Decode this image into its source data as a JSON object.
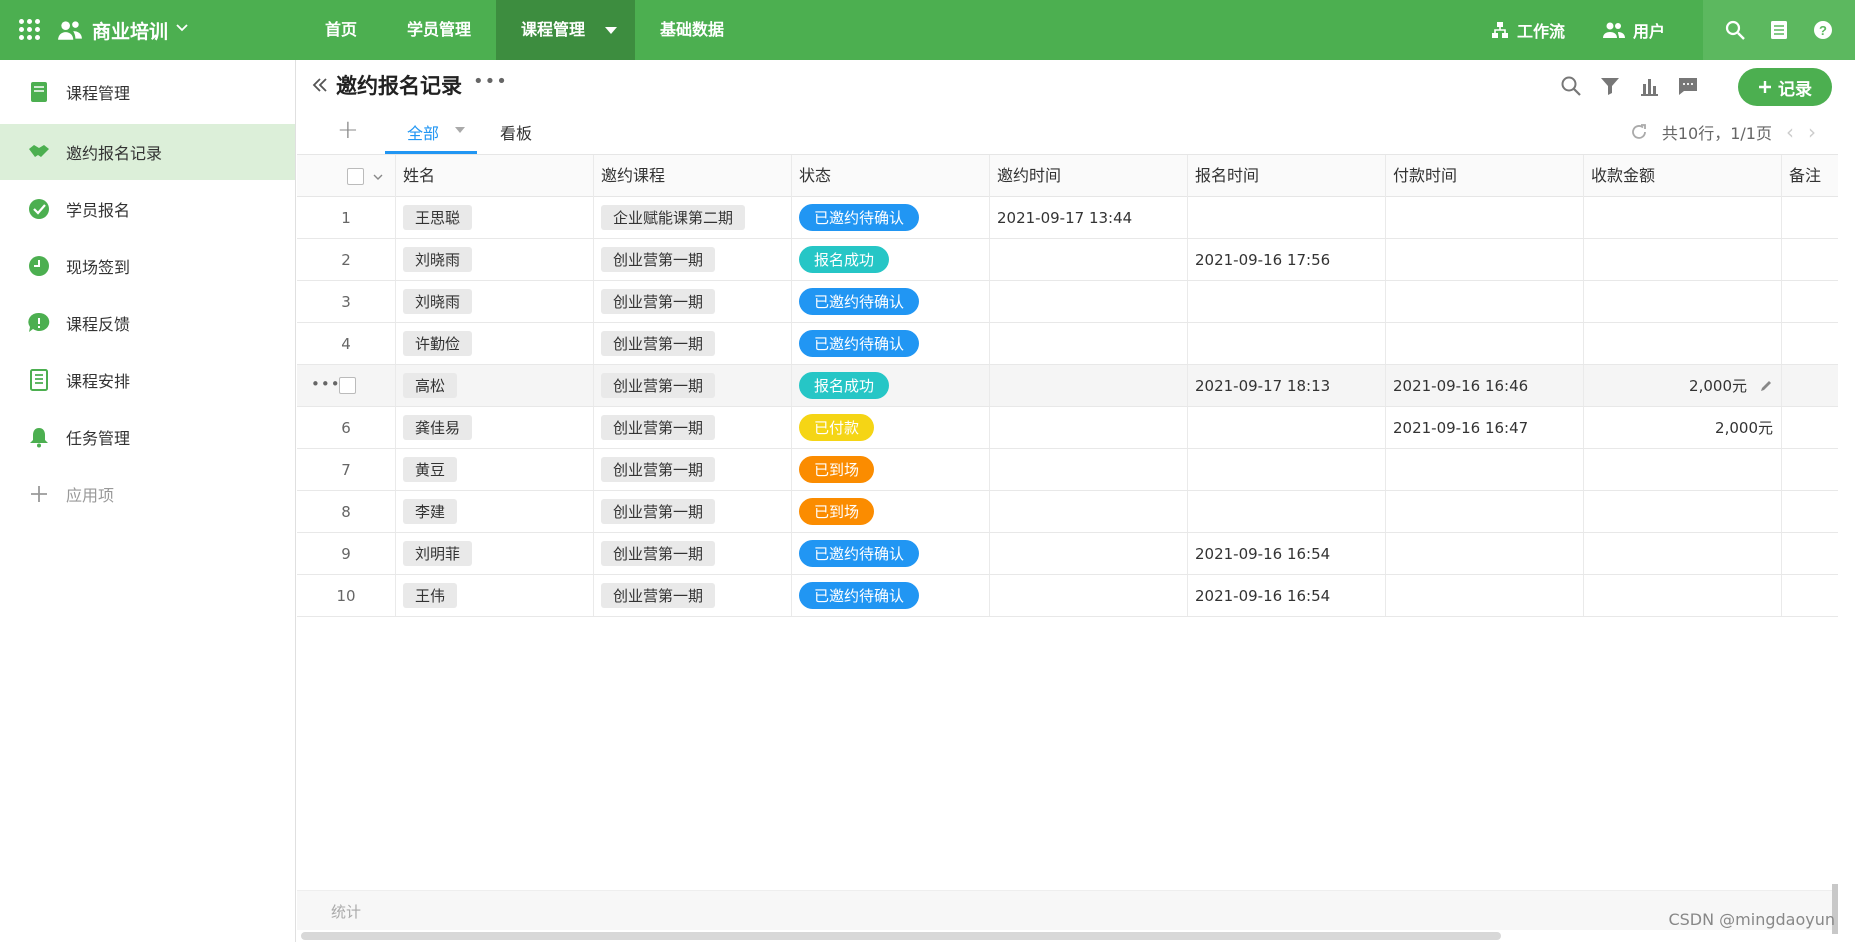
{
  "topbar": {
    "app_title": "商业培训",
    "nav": [
      "首页",
      "学员管理",
      "课程管理",
      "基础数据"
    ],
    "active_nav": "课程管理",
    "workflow_label": "工作流",
    "users_label": "用户",
    "brand_color": "#4caf50"
  },
  "sidebar": {
    "items": [
      {
        "label": "课程管理",
        "icon": "book-icon"
      },
      {
        "label": "邀约报名记录",
        "icon": "handshake-icon"
      },
      {
        "label": "学员报名",
        "icon": "check-circle-icon"
      },
      {
        "label": "现场签到",
        "icon": "clock-icon"
      },
      {
        "label": "课程反馈",
        "icon": "chat-bubble-icon"
      },
      {
        "label": "课程安排",
        "icon": "list-icon"
      },
      {
        "label": "任务管理",
        "icon": "bell-icon"
      }
    ],
    "add_app_label": "应用项"
  },
  "view": {
    "title": "邀约报名记录",
    "add_record_label": "记录",
    "tabs": [
      "全部",
      "看板"
    ],
    "pager_text": "共10行，1/1页"
  },
  "table": {
    "columns": [
      "姓名",
      "邀约课程",
      "状态",
      "邀约时间",
      "报名时间",
      "付款时间",
      "收款金额",
      "备注"
    ],
    "rows": [
      {
        "no": "1",
        "name": "王思聪",
        "course": "企业赋能课第二期",
        "status": "已邀约待确认",
        "status_color": "blue",
        "invite_time": "2021-09-17 13:44",
        "signup_time": "",
        "pay_time": "",
        "amount": ""
      },
      {
        "no": "2",
        "name": "刘晓雨",
        "course": "创业营第一期",
        "status": "报名成功",
        "status_color": "teal",
        "invite_time": "",
        "signup_time": "2021-09-16 17:56",
        "pay_time": "",
        "amount": ""
      },
      {
        "no": "3",
        "name": "刘晓雨",
        "course": "创业营第一期",
        "status": "已邀约待确认",
        "status_color": "blue",
        "invite_time": "",
        "signup_time": "",
        "pay_time": "",
        "amount": ""
      },
      {
        "no": "4",
        "name": "许勤俭",
        "course": "创业营第一期",
        "status": "已邀约待确认",
        "status_color": "blue",
        "invite_time": "",
        "signup_time": "",
        "pay_time": "",
        "amount": ""
      },
      {
        "no": "",
        "name": "高松",
        "course": "创业营第一期",
        "status": "报名成功",
        "status_color": "teal",
        "invite_time": "",
        "signup_time": "2021-09-17 18:13",
        "pay_time": "2021-09-16 16:46",
        "amount": "2,000元"
      },
      {
        "no": "6",
        "name": "龚佳易",
        "course": "创业营第一期",
        "status": "已付款",
        "status_color": "yellow",
        "invite_time": "",
        "signup_time": "",
        "pay_time": "2021-09-16 16:47",
        "amount": "2,000元"
      },
      {
        "no": "7",
        "name": "黄豆",
        "course": "创业营第一期",
        "status": "已到场",
        "status_color": "orange",
        "invite_time": "",
        "signup_time": "",
        "pay_time": "",
        "amount": ""
      },
      {
        "no": "8",
        "name": "李建",
        "course": "创业营第一期",
        "status": "已到场",
        "status_color": "orange",
        "invite_time": "",
        "signup_time": "",
        "pay_time": "",
        "amount": ""
      },
      {
        "no": "9",
        "name": "刘明菲",
        "course": "创业营第一期",
        "status": "已邀约待确认",
        "status_color": "blue",
        "invite_time": "",
        "signup_time": "2021-09-16 16:54",
        "pay_time": "",
        "amount": ""
      },
      {
        "no": "10",
        "name": "王伟",
        "course": "创业营第一期",
        "status": "已邀约待确认",
        "status_color": "blue",
        "invite_time": "",
        "signup_time": "2021-09-16 16:54",
        "pay_time": "",
        "amount": ""
      }
    ],
    "hovered_row": 4
  },
  "footer": {
    "stats_label": "统计",
    "watermark": "CSDN @mingdaoyun"
  }
}
